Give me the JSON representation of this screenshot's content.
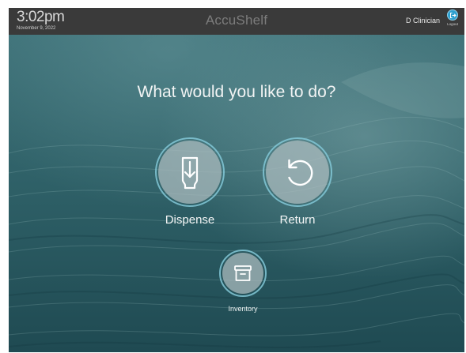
{
  "header": {
    "time": "3:02pm",
    "date": "November 9, 2022",
    "app_name": "AccuShelf",
    "user_name": "D Clinician",
    "logout_label": "Logout"
  },
  "main": {
    "prompt": "What would you like to do?",
    "actions": [
      {
        "label": "Dispense",
        "icon": "dispense-icon"
      },
      {
        "label": "Return",
        "icon": "return-icon"
      },
      {
        "label": "Inventory",
        "icon": "archive-box-icon"
      }
    ]
  },
  "colors": {
    "header_bg": "#3a3a3a",
    "brand_text": "#7c7c7c",
    "accent_ring": "#82c8d7",
    "logout_button": "#2ea0cf",
    "background_water": "#2f5b62"
  }
}
